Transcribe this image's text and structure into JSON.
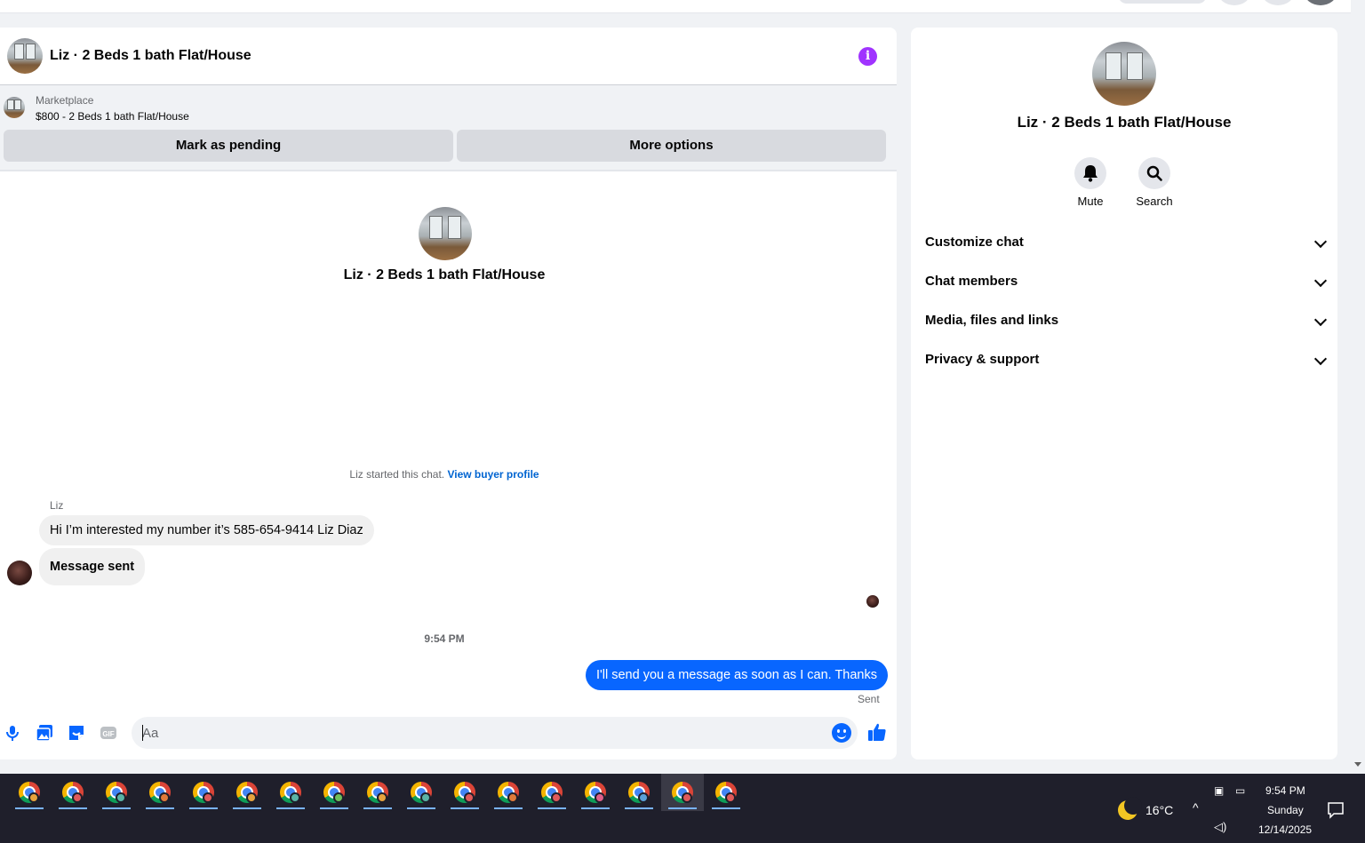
{
  "chat": {
    "title": "Liz · 2 Beds 1 bath Flat/House",
    "marketplace_label": "Marketplace",
    "listing": "$800 - 2 Beds 1 bath Flat/House",
    "mark_pending": "Mark as pending",
    "more_options": "More options",
    "intro_title": "Liz · 2 Beds 1 bath Flat/House",
    "started_text": "Liz started this chat.",
    "view_buyer_profile": "View buyer profile",
    "sender_name": "Liz",
    "messages": [
      {
        "from": "Liz",
        "text": "Hi I’m interested my number it’s 585-654-9414 Liz Diaz"
      },
      {
        "from": "Liz",
        "text": "Message sent"
      },
      {
        "from": "me",
        "text": "I'll send you a message as soon as I can. Thanks"
      }
    ],
    "timestamp": "9:54 PM",
    "sent_status": "Sent",
    "composer_placeholder": "Aa"
  },
  "info_panel": {
    "title": "Liz · 2 Beds 1 bath Flat/House",
    "actions": [
      {
        "label": "Mute",
        "icon": "bell-icon"
      },
      {
        "label": "Search",
        "icon": "search-icon"
      }
    ],
    "sections": [
      "Customize chat",
      "Chat members",
      "Media, files and links",
      "Privacy & support"
    ]
  },
  "taskbar": {
    "app_count": 17,
    "active_index": 15,
    "temperature": "16°C",
    "time": "9:54 PM",
    "day": "Sunday",
    "date": "12/14/2025"
  },
  "colors": {
    "accent": "#0866ff",
    "info": "#a033ff",
    "taskbar": "#1f1f2b"
  }
}
